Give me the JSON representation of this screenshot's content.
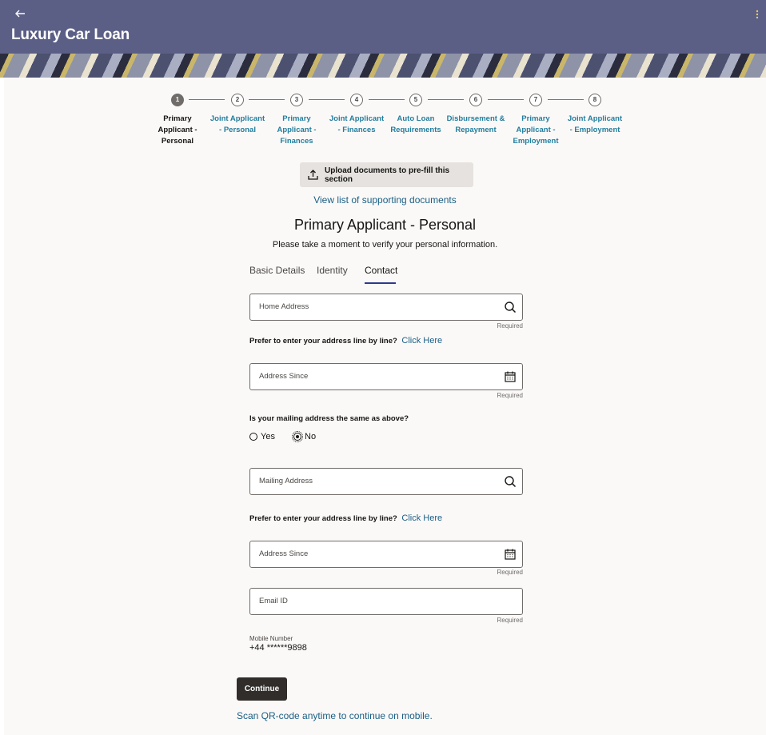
{
  "header": {
    "back_icon": "arrow-left-icon",
    "title": "Luxury Car Loan",
    "menu_icon": "kebab-menu-icon"
  },
  "train": {
    "steps": [
      {
        "number": "1",
        "label": "Primary Applicant - Personal",
        "state": "active"
      },
      {
        "number": "2",
        "label": "Joint Applicant - Personal",
        "state": "pending"
      },
      {
        "number": "3",
        "label": "Primary Applicant - Finances",
        "state": "pending"
      },
      {
        "number": "4",
        "label": "Joint Applicant - Finances",
        "state": "pending"
      },
      {
        "number": "5",
        "label": "Auto Loan Requirements",
        "state": "pending"
      },
      {
        "number": "6",
        "label": "Disbursement & Repayment",
        "state": "pending"
      },
      {
        "number": "7",
        "label": "Primary Applicant - Employment",
        "state": "pending"
      },
      {
        "number": "8",
        "label": "Joint Applicant - Employment",
        "state": "pending"
      }
    ]
  },
  "upload": {
    "label": "Upload documents to pre-fill this section",
    "icon": "upload-icon"
  },
  "view_docs_link": "View list of supporting documents",
  "section": {
    "title": "Primary Applicant - Personal",
    "subtitle": "Please take a moment to verify your personal information."
  },
  "tabs": [
    {
      "label": "Basic Details",
      "active": false
    },
    {
      "label": "Identity",
      "active": false
    },
    {
      "label": "Contact",
      "active": true
    }
  ],
  "form": {
    "home_address": {
      "placeholder": "Home Address",
      "value": "",
      "helper": "Required",
      "icon": "search-icon"
    },
    "prefer_text": "Prefer to enter your address line by line?",
    "click_here": "Click Here",
    "address_since_1": {
      "placeholder": "Address Since",
      "value": "",
      "helper": "Required",
      "icon": "calendar-icon"
    },
    "mailing_question": "Is your mailing address the same as above?",
    "mailing_options": [
      {
        "label": "Yes",
        "selected": false
      },
      {
        "label": "No",
        "selected": true
      }
    ],
    "mailing_address": {
      "placeholder": "Mailing Address",
      "value": "",
      "icon": "search-icon"
    },
    "prefer_text_2": "Prefer to enter your address line by line?",
    "click_here_2": "Click Here",
    "address_since_2": {
      "placeholder": "Address Since",
      "value": "",
      "helper": "Required",
      "icon": "calendar-icon"
    },
    "email": {
      "placeholder": "Email ID",
      "value": "",
      "helper": "Required"
    },
    "mobile": {
      "label": "Mobile Number",
      "value": "+44 ******9898"
    }
  },
  "actions": {
    "continue_label": "Continue",
    "qr_link": "Scan QR-code anytime to continue on mobile."
  },
  "colors": {
    "header_bg": "#5b5f86",
    "link": "#1a5f84",
    "step_link": "#227e9e",
    "primary_button": "#312d2a",
    "tab_underline": "#2e3a8c"
  }
}
